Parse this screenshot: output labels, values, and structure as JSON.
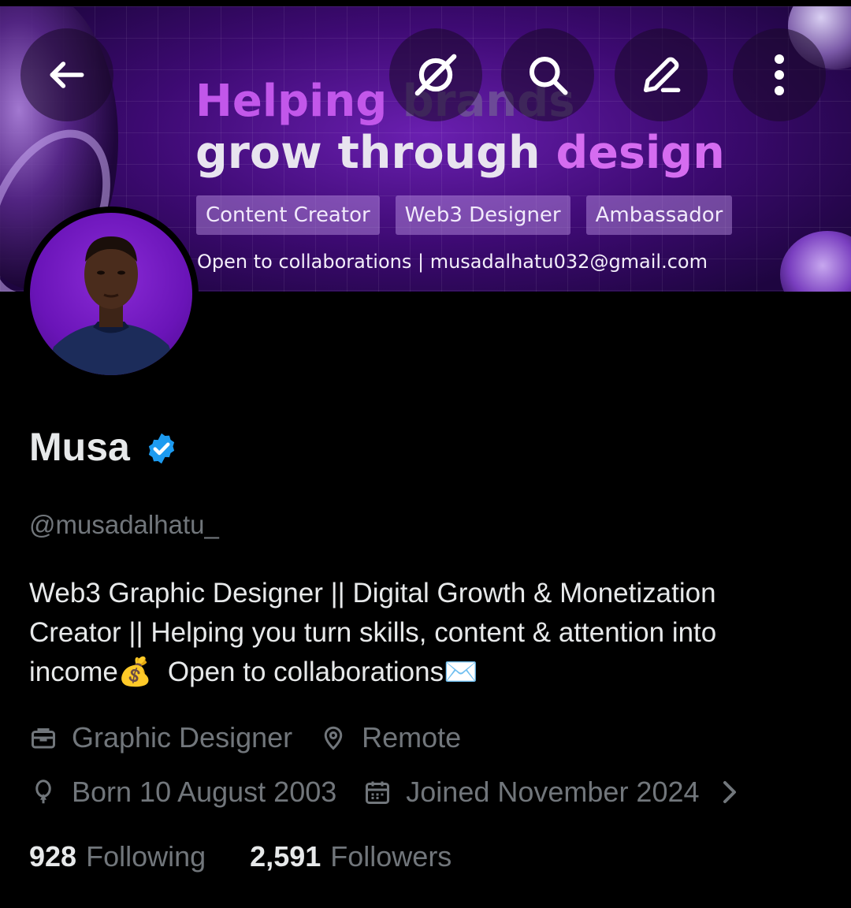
{
  "banner": {
    "headline_part1": "Helping",
    "headline_part2": "brands",
    "headline_line2_a": "grow through",
    "headline_line2_b": "design",
    "chips": [
      "Content Creator",
      "Web3 Designer",
      "Ambassador"
    ],
    "contact": "Open to collaborations | musadalhatu032@gmail.com"
  },
  "topbar": {
    "back_icon": "arrow-left-icon",
    "actions": [
      "grok-icon",
      "search-icon",
      "edit-icon",
      "more-vertical-icon"
    ]
  },
  "profile": {
    "name": "Musa",
    "verified_icon": "verified-badge-icon",
    "handle": "@musadalhatu_",
    "bio_line1": "Web3 Graphic Designer ||  Digital Growth & Monetization",
    "bio_line2": "Creator || Helping you turn skills, content & attention into",
    "bio_line3a": "income",
    "bio_emoji1": "💰",
    "bio_line3b": "Open to collaborations",
    "bio_emoji2": "✉️",
    "profession": "Graphic Designer",
    "location": "Remote",
    "birth": "Born 10 August 2003",
    "joined": "Joined November 2024"
  },
  "stats": {
    "following_count": "928",
    "following_label": "Following",
    "followers_count": "2,591",
    "followers_label": "Followers"
  },
  "colors": {
    "background": "#000000",
    "text_primary": "#e7e9ea",
    "text_secondary": "#71767b",
    "verified": "#1d9bf0",
    "banner_purple": "#6a1fb0"
  }
}
